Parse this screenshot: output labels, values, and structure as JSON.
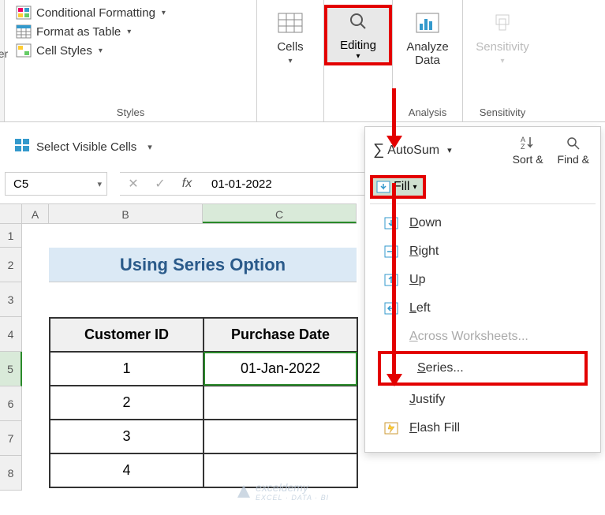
{
  "ribbon": {
    "ber_fragment": "ber",
    "styles": {
      "cond_fmt": "Conditional Formatting",
      "fmt_table": "Format as Table",
      "cell_styles": "Cell Styles",
      "group_label": "Styles"
    },
    "cells": {
      "label": "Cells"
    },
    "editing": {
      "label": "Editing"
    },
    "analyze": {
      "label": "Analyze Data",
      "group_label": "Analysis"
    },
    "sensitivity": {
      "label": "Sensitivity",
      "group_label": "Sensitivity"
    }
  },
  "qat": {
    "label": "Select Visible Cells"
  },
  "namebox": {
    "ref": "C5"
  },
  "formula_bar": {
    "value": "01-01-2022"
  },
  "columns": {
    "A": "A",
    "B": "B",
    "C": "C"
  },
  "rows": [
    "1",
    "2",
    "3",
    "4",
    "5",
    "6",
    "7",
    "8"
  ],
  "sheet": {
    "title": "Using Series Option",
    "headers": {
      "id": "Customer ID",
      "date": "Purchase Date"
    },
    "data": [
      {
        "id": "1",
        "date": "01-Jan-2022"
      },
      {
        "id": "2",
        "date": ""
      },
      {
        "id": "3",
        "date": ""
      },
      {
        "id": "4",
        "date": ""
      }
    ]
  },
  "editing_panel": {
    "autosum": "AutoSum",
    "sort": "Sort &",
    "find": "Find &",
    "fill": "Fill",
    "menu": {
      "down": "Down",
      "right": "Right",
      "up": "Up",
      "left": "Left",
      "across": "Across Worksheets...",
      "series": "Series...",
      "justify": "Justify",
      "flash": "Flash Fill"
    }
  },
  "watermark": {
    "brand": "exceldemy",
    "tag": "EXCEL · DATA · BI"
  }
}
